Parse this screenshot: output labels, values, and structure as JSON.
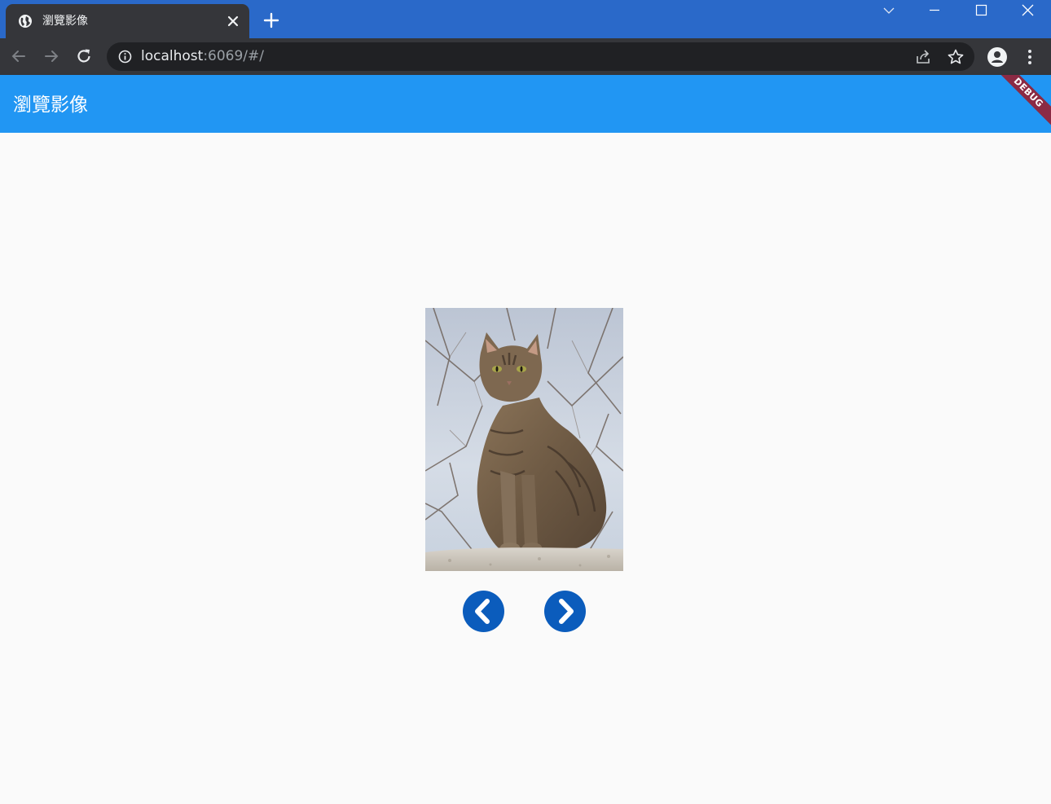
{
  "browser": {
    "tab": {
      "title": "瀏覽影像",
      "favicon": "globe-icon"
    },
    "address": {
      "host": "localhost",
      "rest": ":6069/#/"
    }
  },
  "app": {
    "title": "瀏覽影像",
    "debug_label": "DEBUG",
    "image": {
      "alt": "tabby-cat-photo"
    },
    "controls": {
      "previous_icon": "chevron-left-icon",
      "next_icon": "chevron-right-icon"
    }
  },
  "colors": {
    "browser_frame": "#2a69c9",
    "toolbar": "#35363a",
    "appbar": "#2196f3",
    "nav_button": "#0b5cbc",
    "debug_banner": "#8b2a44"
  }
}
